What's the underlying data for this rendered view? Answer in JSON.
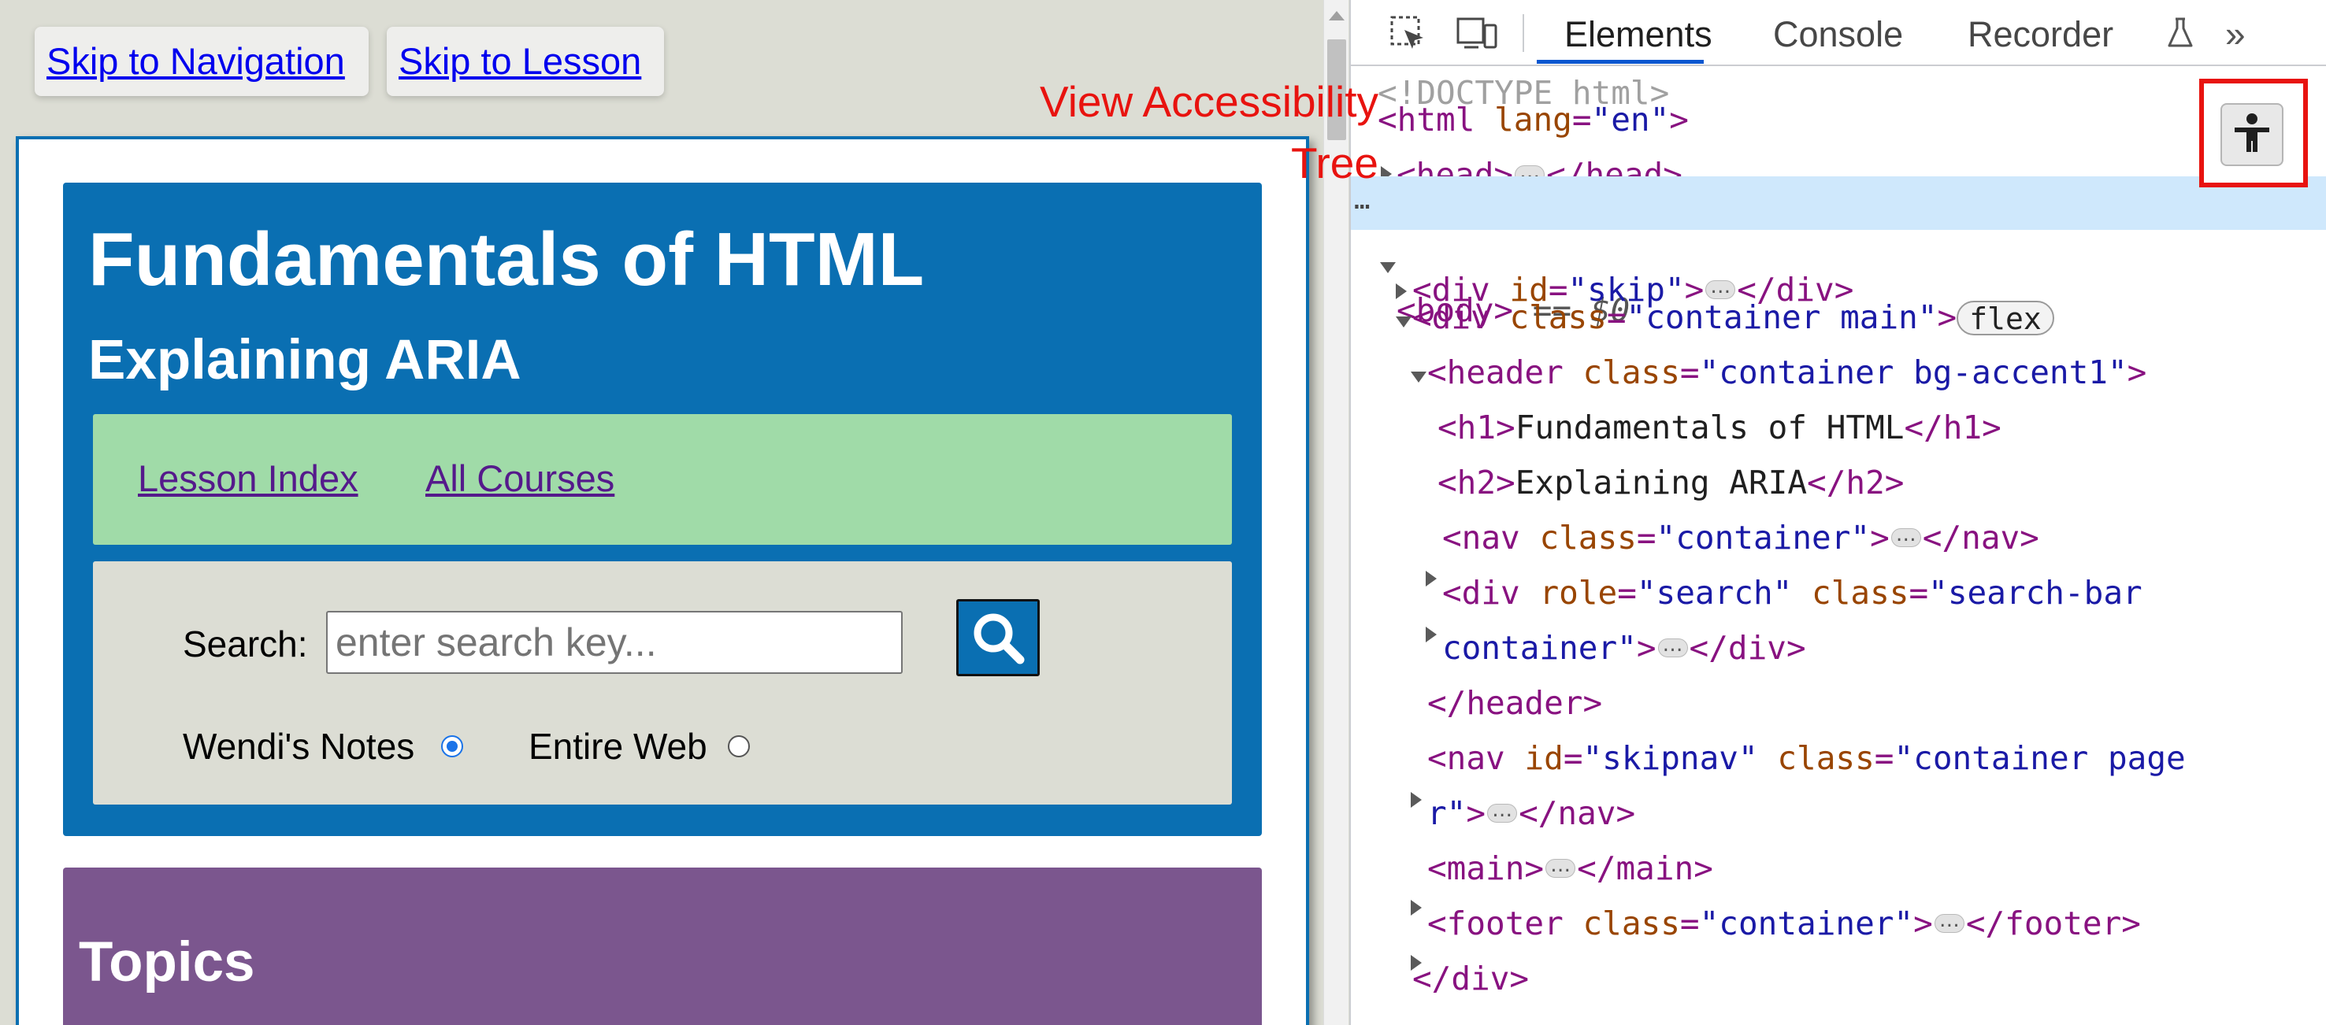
{
  "page": {
    "skip_links": {
      "navigation": "Skip to Navigation",
      "lesson": "Skip to Lesson"
    },
    "header": {
      "title": "Fundamentals of HTML",
      "subtitle": "Explaining ARIA"
    },
    "nav": {
      "lesson_index": "Lesson Index",
      "all_courses": "All Courses"
    },
    "search": {
      "label": "Search:",
      "placeholder": "enter search key...",
      "value": "",
      "options": [
        {
          "label": "Wendi's Notes",
          "selected": true
        },
        {
          "label": "Entire Web",
          "selected": false
        }
      ]
    },
    "topics": {
      "title": "Topics"
    }
  },
  "devtools": {
    "tabs": [
      "Elements",
      "Console",
      "Recorder"
    ],
    "active_tab": "Elements",
    "more_tabs": "»",
    "annotation": "View Accessibility Tree",
    "dom": {
      "doctype": "<!DOCTYPE html>",
      "body_marker": "== $0",
      "flex_badge": "flex",
      "h1_text": "Fundamentals of HTML",
      "h2_text": "Explaining ARIA"
    }
  },
  "colors": {
    "header_blue": "#0a6fb2",
    "nav_green": "#a0dba8",
    "topics_purple": "#7b568e",
    "annotation_red": "#e8130f",
    "active_tab_blue": "#0b57d0"
  }
}
